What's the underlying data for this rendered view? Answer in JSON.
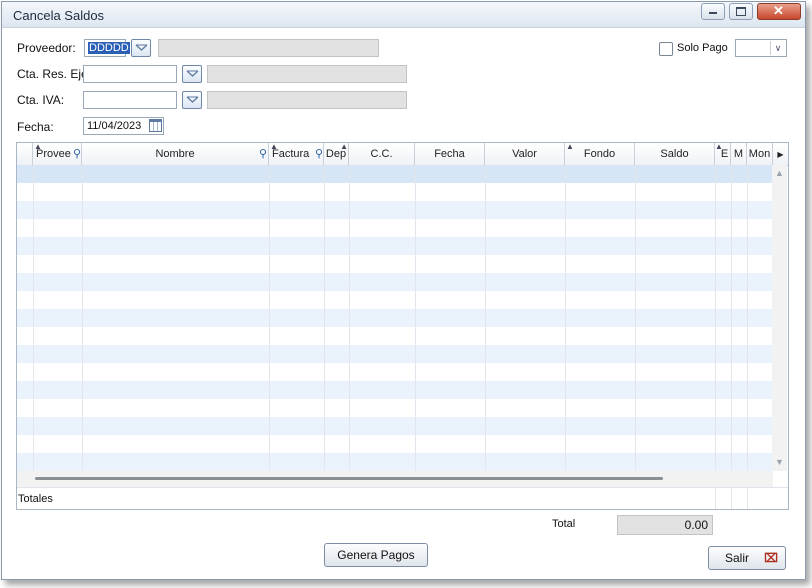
{
  "window": {
    "title": "Cancela Saldos"
  },
  "form": {
    "proveedor_label": "Proveedor:",
    "proveedor_value": "DDDDD",
    "cta_res_label": "Cta. Res. Eje.",
    "cta_iva_label": "Cta. IVA:",
    "fecha_label": "Fecha:",
    "fecha_value": "11/04/2023",
    "solo_pago_label": "Solo Pago"
  },
  "grid": {
    "columns": [
      "Provee",
      "Nombre",
      "Factura",
      "Dep",
      "C.C.",
      "Fecha",
      "Valor",
      "Fondo",
      "Saldo",
      "E",
      "M",
      "Mon"
    ],
    "totals_label": "Totales"
  },
  "footer": {
    "total_label": "Total",
    "total_value": "0.00",
    "genera_pagos_label": "Genera Pagos",
    "salir_label": "Salir"
  },
  "icons": [
    "minimize-icon",
    "maximize-icon",
    "close-icon",
    "search-icon",
    "calendar-icon",
    "dropdown-arrow-icon",
    "sort-icon",
    "scroll-arrow-icon",
    "cancel-x-icon"
  ]
}
